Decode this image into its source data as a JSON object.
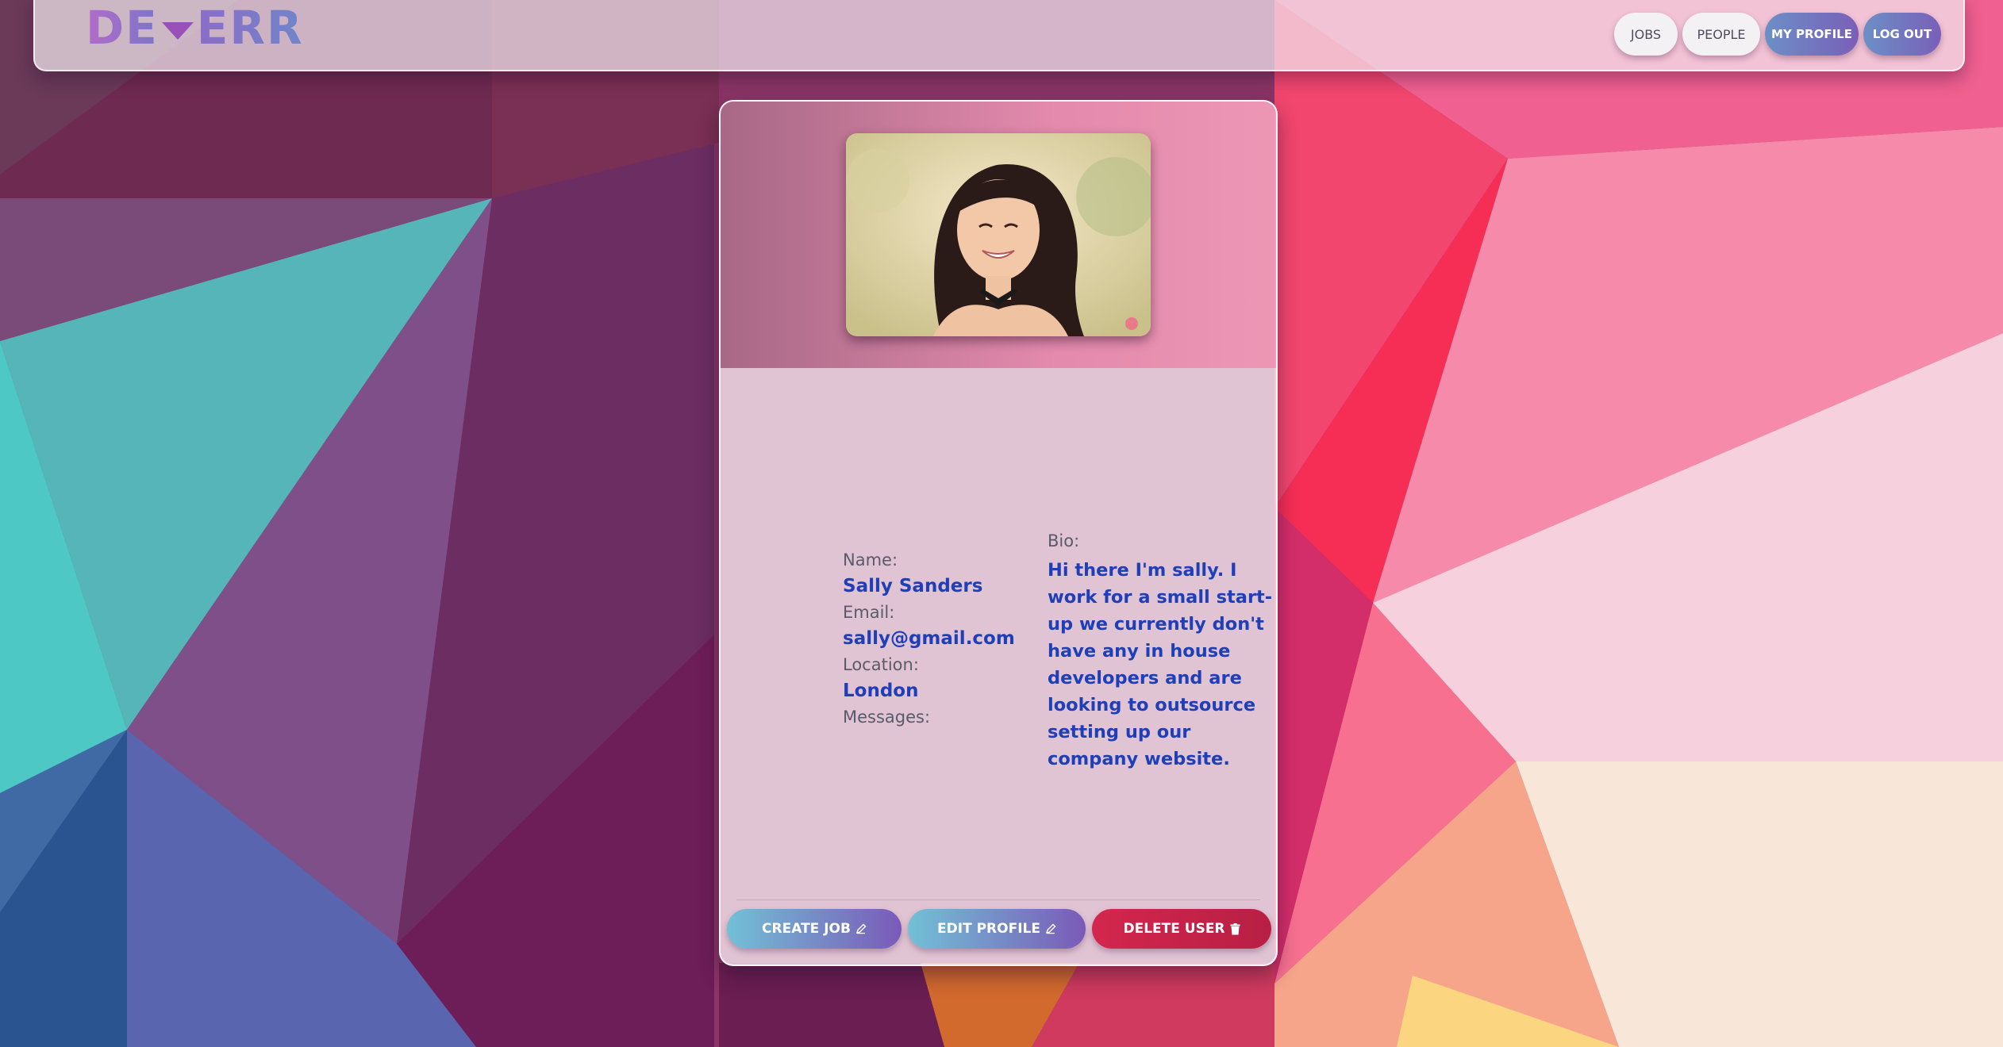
{
  "header": {
    "logo": {
      "part_a": "DE",
      "part_b": "ERR"
    },
    "nav": {
      "jobs": "JOBS",
      "people": "PEOPLE",
      "my_profile": "MY PROFILE",
      "log_out": "LOG OUT"
    }
  },
  "profile": {
    "photo_icon": "profile-photo",
    "name_label": "Name:",
    "name": "Sally Sanders",
    "email_label": "Email:",
    "email": "sally@gmail.com",
    "location_label": "Location:",
    "location": "London",
    "messages_label": "Messages:",
    "bio_label": "Bio:",
    "bio": "Hi there I'm sally. I work for a small start-up we currently don't have any in house developers and are looking to outsource setting up our company website."
  },
  "actions": {
    "create_job": "CREATE JOB",
    "edit_profile": "EDIT PROFILE",
    "delete_user": "DELETE USER",
    "create_icon": "pencil-icon",
    "edit_icon": "pencil-icon",
    "delete_icon": "trash-icon"
  },
  "colors": {
    "accent_text": "#1f3fb8",
    "button_gradient_start": "#72c0d6",
    "button_gradient_end": "#7a5ab8",
    "danger": "#c8224a"
  }
}
